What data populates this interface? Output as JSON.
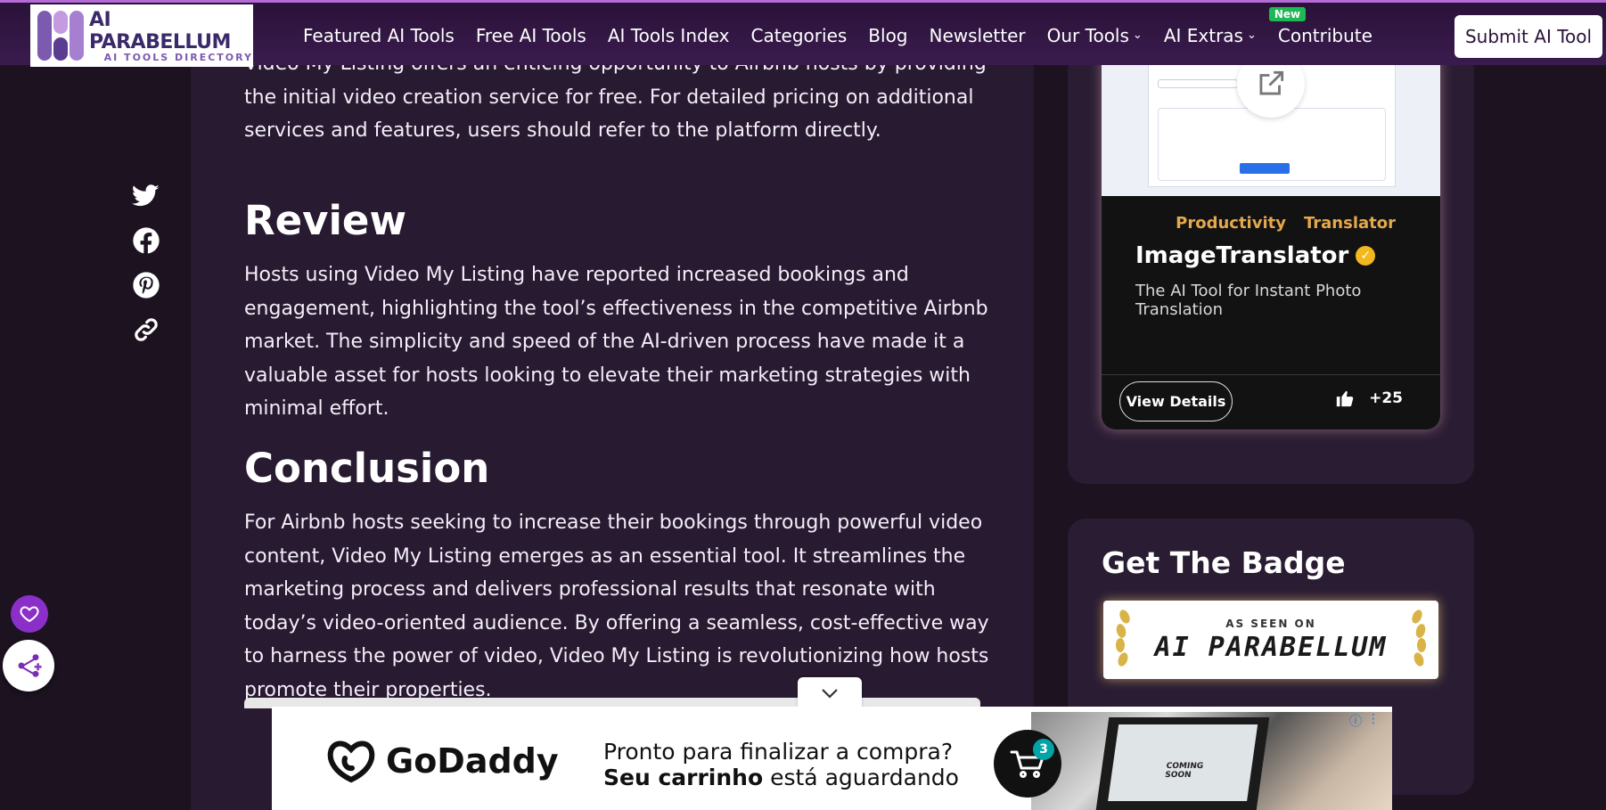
{
  "brand": {
    "name": "AI PARABELLUM",
    "tagline": "AI TOOLS DIRECTORY"
  },
  "nav": {
    "items": [
      {
        "label": "Featured AI Tools"
      },
      {
        "label": "Free AI Tools"
      },
      {
        "label": "AI Tools Index"
      },
      {
        "label": "Categories"
      },
      {
        "label": "Blog"
      },
      {
        "label": "Newsletter"
      },
      {
        "label": "Our Tools"
      },
      {
        "label": "AI Extras"
      },
      {
        "label": "Contribute",
        "badge": "New"
      }
    ],
    "submit_label": "Submit AI Tool"
  },
  "article": {
    "intro_fragment": "Video My Listing offers an enticing opportunity to Airbnb hosts by providing the initial video creation service for free. For detailed pricing on additional services and features, users should refer to the platform directly.",
    "review_heading": "Review",
    "review_text": "Hosts using Video My Listing have reported increased bookings and engagement, highlighting the tool’s effectiveness in the competitive Airbnb market. The simplicity and speed of the AI-driven process have made it a valuable asset for hosts looking to elevate their marketing strategies with minimal effort.",
    "conclusion_heading": "Conclusion",
    "conclusion_text": "For Airbnb hosts seeking to increase their bookings through powerful video content, Video My Listing emerges as an essential tool. It streamlines the marketing process and delivers professional results that resonate with today’s video-oriented audience. By offering a seamless, cost-effective way to harness the power of video, Video My Listing is revolutionizing how hosts promote their properties."
  },
  "share_icons": [
    "twitter-icon",
    "facebook-icon",
    "pinterest-icon",
    "link-icon"
  ],
  "tool_card": {
    "tags": [
      "Productivity",
      "Translator"
    ],
    "name": "ImageTranslator",
    "description": "The AI Tool for Instant Photo Translation",
    "view_label": "View Details",
    "likes": "+25"
  },
  "badge_section": {
    "title": "Get The Badge",
    "badge_top": "AS SEEN ON",
    "badge_main": "AI PARABELLUM"
  },
  "ad": {
    "brand": "GoDaddy",
    "line1": "Pronto para finalizar a compra?",
    "line2_bold": "Seu carrinho",
    "line2_rest": " está aguardando",
    "cart_count": "3",
    "laptop_text": "COMING SOON"
  },
  "colors": {
    "nav_bg": "#2a1238",
    "page_bg": "#1c1220",
    "article_bg": "#271a31",
    "accent_purple": "#8b2fc9",
    "tag_orange": "#e4a84d",
    "verified_gold": "#f2b81d",
    "new_badge_green": "#1db954"
  }
}
